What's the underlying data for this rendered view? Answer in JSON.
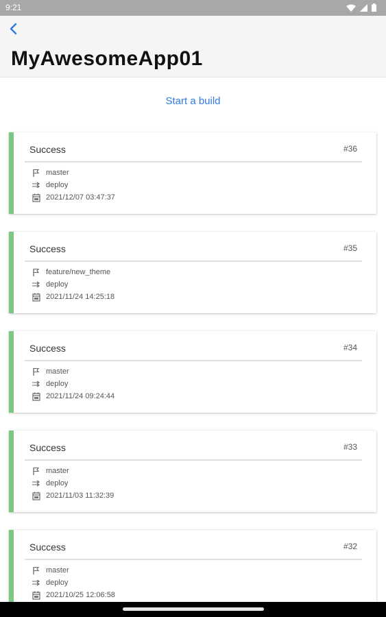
{
  "status_bar": {
    "time": "9:21"
  },
  "header": {
    "title": "MyAwesomeApp01",
    "back_icon": "back-chevron-icon",
    "accent": "#2f7ae5"
  },
  "start_build_label": "Start a build",
  "success_color": "#7cc883",
  "builds": [
    {
      "status": "Success",
      "number": "#36",
      "branch": "master",
      "workflow": "deploy",
      "date": "2021/12/07 03:47:37"
    },
    {
      "status": "Success",
      "number": "#35",
      "branch": "feature/new_theme",
      "workflow": "deploy",
      "date": "2021/11/24 14:25:18"
    },
    {
      "status": "Success",
      "number": "#34",
      "branch": "master",
      "workflow": "deploy",
      "date": "2021/11/24 09:24:44"
    },
    {
      "status": "Success",
      "number": "#33",
      "branch": "master",
      "workflow": "deploy",
      "date": "2021/11/03 11:32:39"
    },
    {
      "status": "Success",
      "number": "#32",
      "branch": "master",
      "workflow": "deploy",
      "date": "2021/10/25 12:06:58"
    }
  ]
}
